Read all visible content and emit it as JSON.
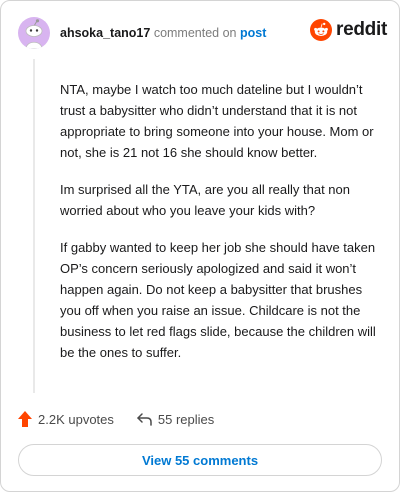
{
  "header": {
    "username": "ahsoka_tano17",
    "commented_text": "commented on",
    "post_link": "post"
  },
  "brand": {
    "name": "reddit",
    "color": "#ff4500"
  },
  "comment": {
    "paragraphs": [
      "NTA, maybe I watch too much dateline but I wouldn’t trust a babysitter who didn’t understand that it is not appropriate to bring someone into your house. Mom or not, she is 21 not 16 she should know better.",
      "Im surprised all the YTA, are you all really that non worried about who you leave your kids with?",
      "If gabby wanted to keep her job she should have taken OP’s concern seriously apologized and said it won’t happen again. Do not keep a babysitter that brushes you off when you raise an issue. Childcare is not the business to let red flags slide, because the children will be the ones to suffer."
    ]
  },
  "footer": {
    "upvotes": "2.2K upvotes",
    "replies": "55 replies",
    "upvote_icon": "upvote-arrow-icon",
    "reply_icon": "reply-arrow-icon"
  },
  "actions": {
    "view_comments": "View 55 comments"
  },
  "colors": {
    "accent": "#0079d3",
    "upvote": "#ff4500",
    "avatar_bg": "#d8b4f0"
  }
}
